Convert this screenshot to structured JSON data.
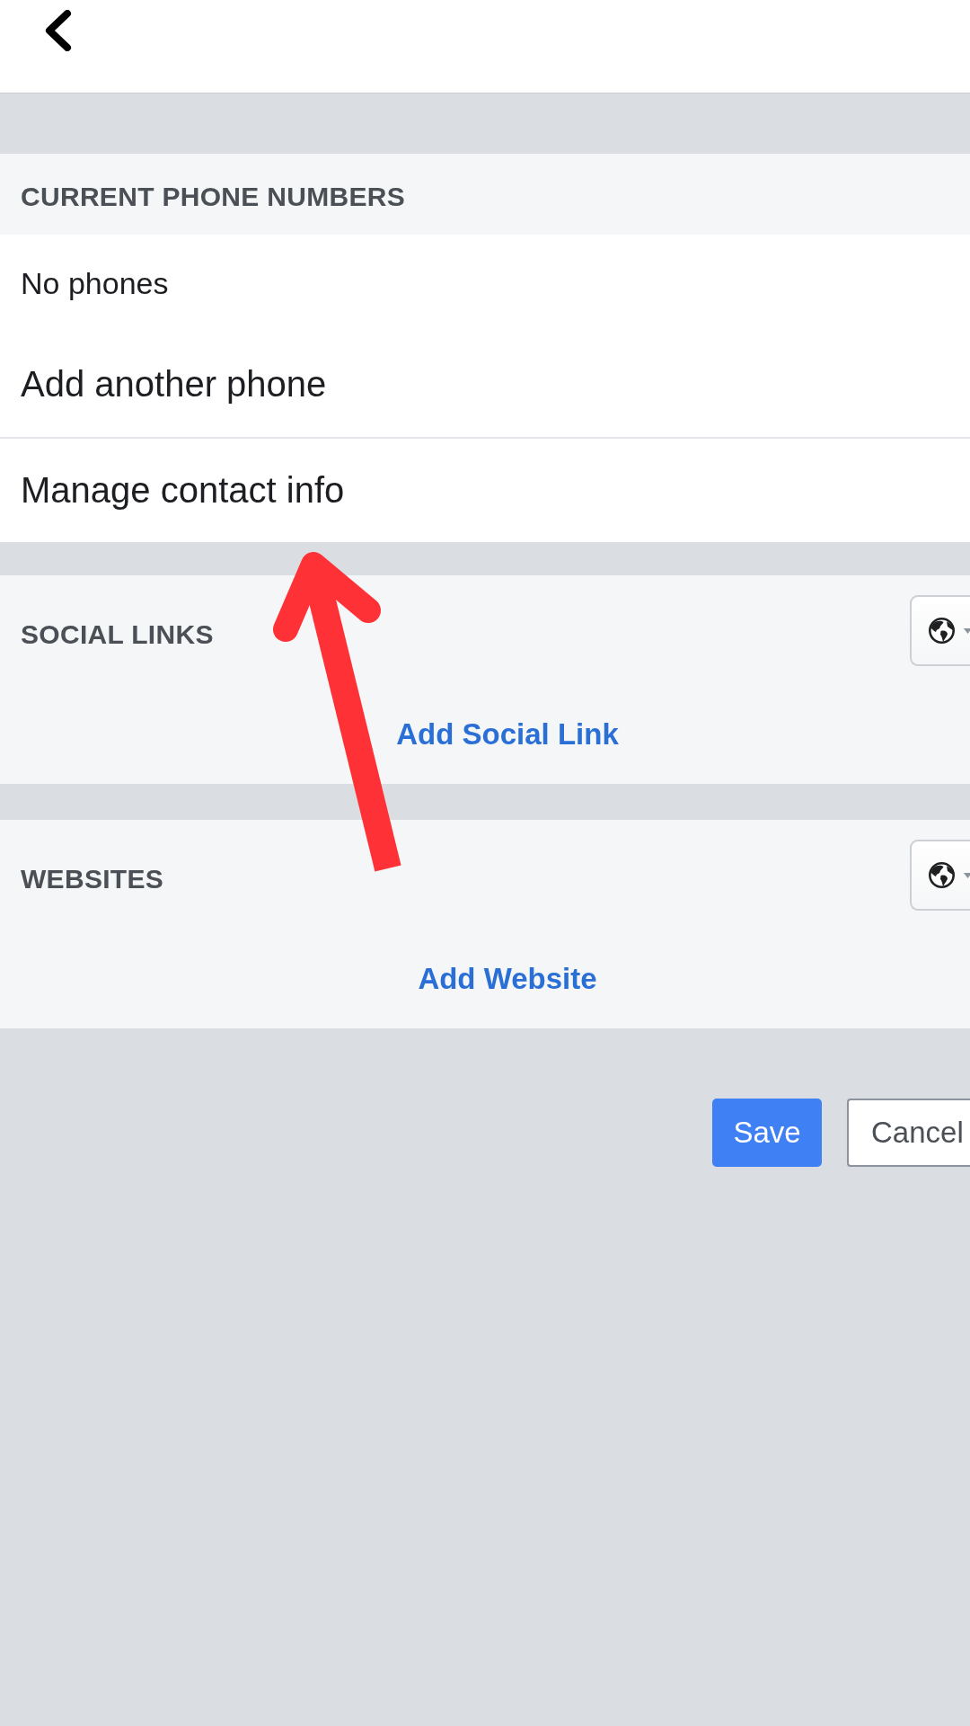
{
  "sections": [
    {
      "kind": "list",
      "heading": "CURRENT PHONE NUMBERS",
      "items": [
        {
          "kind": "note",
          "label": "No phones"
        },
        {
          "kind": "action",
          "label": "Add another phone"
        },
        {
          "kind": "action",
          "label": "Manage contact info"
        }
      ]
    },
    {
      "kind": "links",
      "heading": "SOCIAL LINKS",
      "add_link": "Add Social Link"
    },
    {
      "kind": "links",
      "heading": "WEBSITES",
      "add_link": "Add Website"
    }
  ],
  "buttons": [
    {
      "kind": "primary",
      "label": "Save"
    },
    {
      "kind": "secondary",
      "label": "Cancel"
    }
  ]
}
